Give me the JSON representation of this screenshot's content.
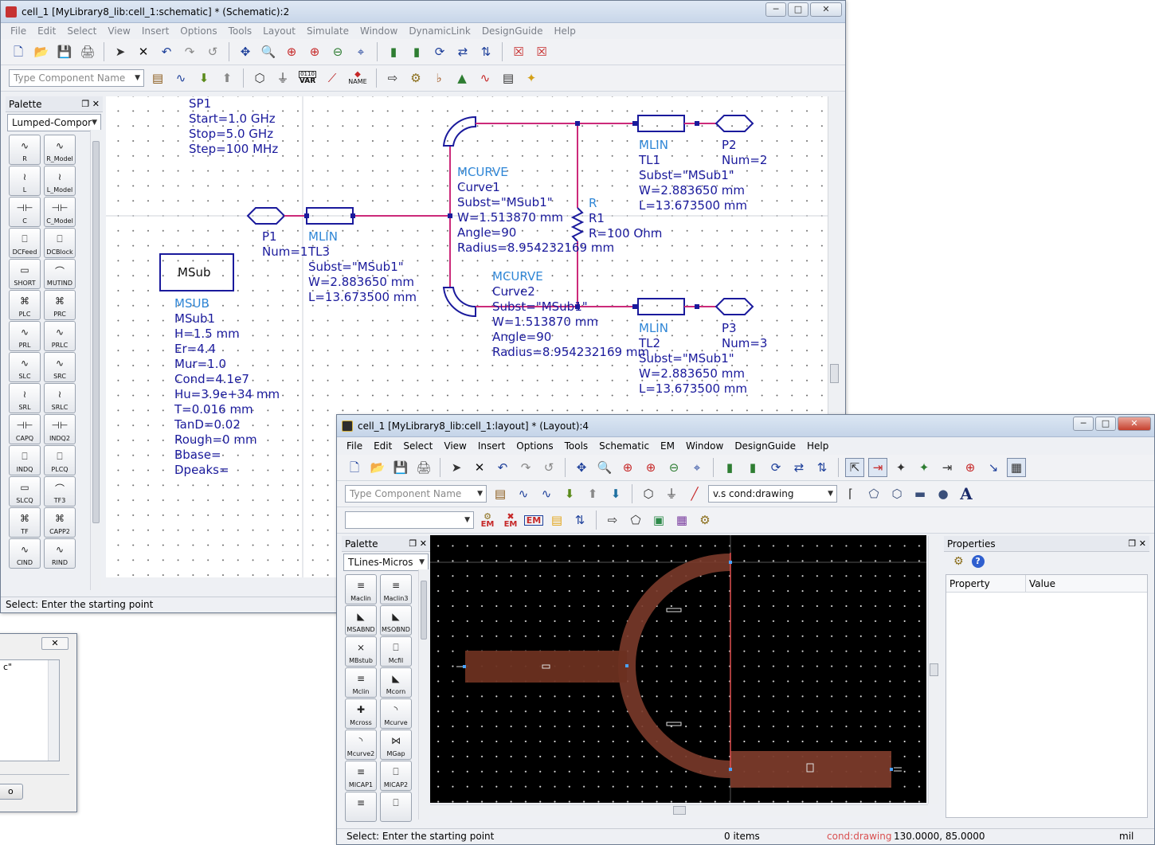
{
  "schematic": {
    "title": "cell_1 [MyLibrary8_lib:cell_1:schematic] * (Schematic):2",
    "menu": [
      "File",
      "Edit",
      "Select",
      "View",
      "Insert",
      "Options",
      "Tools",
      "Layout",
      "Simulate",
      "Window",
      "DynamicLink",
      "DesignGuide",
      "Help"
    ],
    "component_placeholder": "Type Component Name",
    "var_label": "VAR",
    "name_label": "NAME",
    "var_digits": "0110",
    "palette": {
      "title": "Palette",
      "category": "Lumped-Compor",
      "items": [
        "R",
        "R_Model",
        "L",
        "L_Model",
        "C",
        "C_Model",
        "DCFeed",
        "DCBlock",
        "SHORT",
        "MUTIND",
        "PLC",
        "PRC",
        "PRL",
        "PRLC",
        "SLC",
        "SRC",
        "SRL",
        "SRLC",
        "CAPQ",
        "INDQ2",
        "INDQ",
        "PLCQ",
        "SLCQ",
        "TF3",
        "TF",
        "CAPP2",
        "CIND",
        "RIND"
      ]
    },
    "components": {
      "sp1": {
        "name": "SP1",
        "start": "Start=1.0 GHz",
        "stop": "Stop=5.0 GHz",
        "step": "Step=100 MHz"
      },
      "msub": {
        "box": "MSub",
        "type": "MSUB",
        "name": "MSub1",
        "params": [
          "H=1.5 mm",
          "Er=4.4",
          "Mur=1.0",
          "Cond=4.1e7",
          "Hu=3.9e+34 mm",
          "T=0.016 mm",
          "TanD=0.02",
          "Rough=0 mm",
          "Bbase=",
          "Dpeaks="
        ]
      },
      "p1": {
        "name": "P1",
        "num": "Num=1"
      },
      "tl3": {
        "type": "MLIN",
        "name": "TL3",
        "params": [
          "Subst=\"MSub1\"",
          "W=2.883650 mm",
          "L=13.673500 mm"
        ]
      },
      "curve1": {
        "type": "MCURVE",
        "name": "Curve1",
        "params": [
          "Subst=\"MSub1\"",
          "W=1.513870 mm",
          "Angle=90",
          "Radius=8.954232169 mm"
        ]
      },
      "r1": {
        "type": "R",
        "name": "R1",
        "value": "R=100 Ohm"
      },
      "curve2": {
        "type": "MCURVE",
        "name": "Curve2",
        "params": [
          "Subst=\"MSub1\"",
          "W=1.513870 mm",
          "Angle=90",
          "Radius=8.954232169 mm"
        ]
      },
      "tl1": {
        "type": "MLIN",
        "name": "TL1",
        "params": [
          "Subst=\"MSub1\"",
          "W=2.883650 mm",
          "L=13.673500 mm"
        ]
      },
      "p2": {
        "name": "P2",
        "num": "Num=2"
      },
      "tl2": {
        "type": "MLIN",
        "name": "TL2",
        "params": [
          "Subst=\"MSub1\"",
          "W=2.883650 mm",
          "L=13.673500 mm"
        ]
      },
      "p3": {
        "name": "P3",
        "num": "Num=3"
      }
    },
    "status": "Select: Enter the starting point"
  },
  "layout": {
    "title": "cell_1 [MyLibrary8_lib:cell_1:layout] * (Layout):4",
    "menu": [
      "File",
      "Edit",
      "Select",
      "View",
      "Insert",
      "Options",
      "Tools",
      "Schematic",
      "EM",
      "Window",
      "DesignGuide",
      "Help"
    ],
    "component_placeholder": "Type Component Name",
    "layer_select": "v.s cond:drawing",
    "em_label": "EM",
    "palette": {
      "title": "Palette",
      "category": "TLines-Micros",
      "items": [
        "Maclin",
        "Maclin3",
        "MSABND",
        "MSOBND",
        "MBstub",
        "Mcfil",
        "Mclin",
        "Mcorn",
        "Mcross",
        "Mcurve",
        "Mcurve2",
        "MGap",
        "MICAP1",
        "MICAP2",
        "",
        ""
      ]
    },
    "properties": {
      "title": "Properties",
      "col_property": "Property",
      "col_value": "Value"
    },
    "status": {
      "message": "Select: Enter the starting point",
      "items": "0 items",
      "layer": "cond:drawing",
      "coords": "130.0000, 85.0000",
      "units": "mil"
    },
    "colors": {
      "trace": "#7a3a2a",
      "trace_dark": "#5e2a1e",
      "origin_line": "#e05050"
    }
  },
  "dialog": {
    "text": "c\"",
    "button": "o"
  }
}
